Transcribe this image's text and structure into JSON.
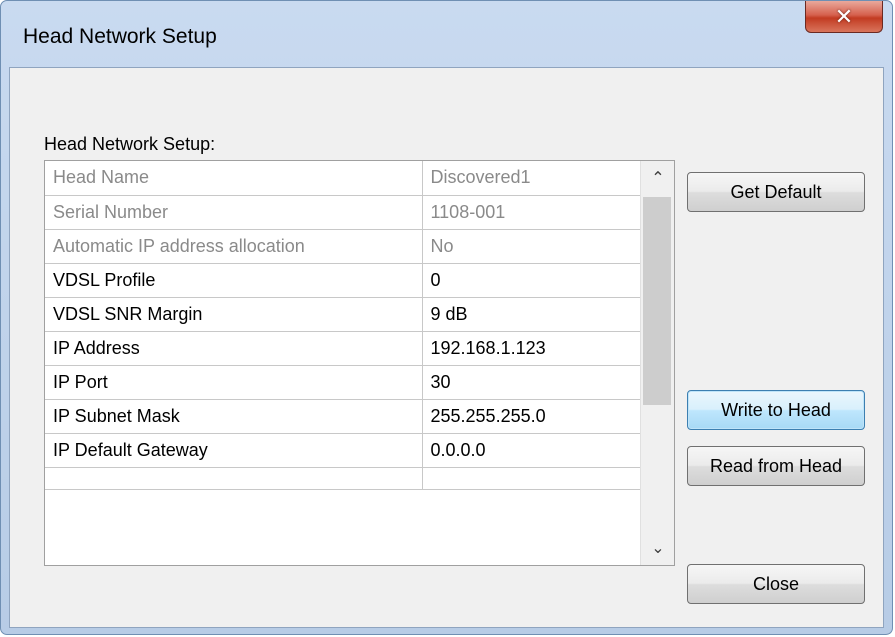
{
  "window": {
    "title": "Head Network Setup",
    "close_glyph": "✕"
  },
  "group": {
    "label": "Head Network Setup:"
  },
  "properties": [
    {
      "name": "Head Name",
      "value": "Discovered1",
      "readonly": true
    },
    {
      "name": "Serial Number",
      "value": "1108-001",
      "readonly": true
    },
    {
      "name": "Automatic IP address allocation",
      "value": "No",
      "readonly": true
    },
    {
      "name": "VDSL Profile",
      "value": "0",
      "readonly": false
    },
    {
      "name": "VDSL SNR Margin",
      "value": "9 dB",
      "readonly": false
    },
    {
      "name": "IP Address",
      "value": "192.168.1.123",
      "readonly": false
    },
    {
      "name": "IP Port",
      "value": "30",
      "readonly": false
    },
    {
      "name": "IP Subnet Mask",
      "value": "255.255.255.0",
      "readonly": false
    },
    {
      "name": "IP Default Gateway",
      "value": "0.0.0.0",
      "readonly": false
    }
  ],
  "scrollbar": {
    "up_glyph": "⌃",
    "down_glyph": "⌄"
  },
  "buttons": {
    "get_default": "Get Default",
    "write_to_head": "Write to Head",
    "read_from_head": "Read from Head",
    "close": "Close"
  },
  "colors": {
    "readonly_text": "#8a8a8a",
    "editable_text": "#000000",
    "close_button": "#c23b22"
  }
}
